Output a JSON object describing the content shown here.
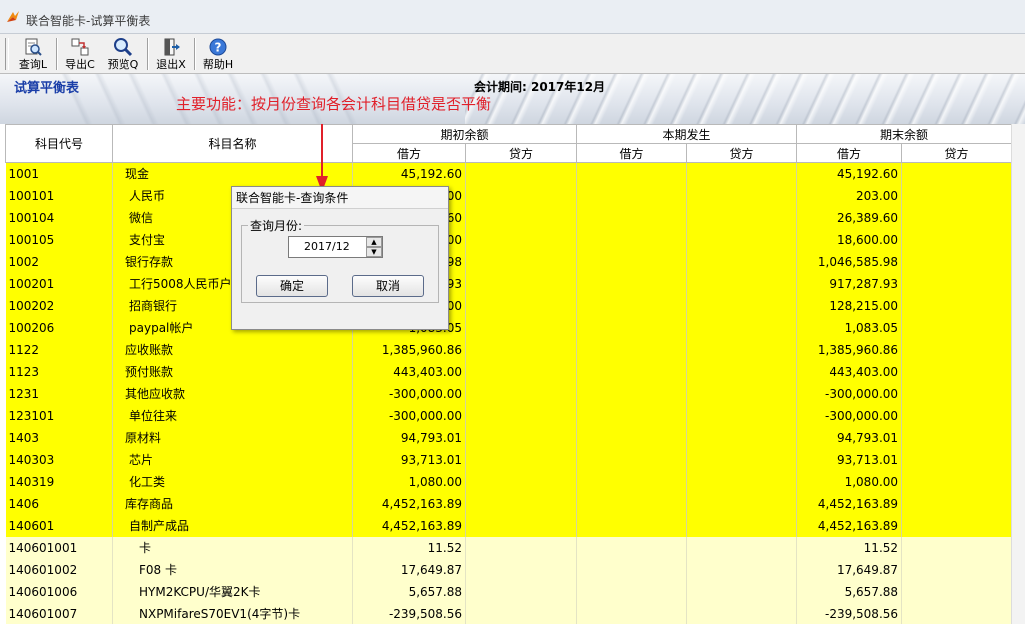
{
  "window": {
    "title": "联合智能卡-试算平衡表"
  },
  "toolbar": {
    "items": [
      {
        "label": "查询L",
        "icon": "query-icon"
      },
      {
        "label": "导出C",
        "icon": "export-icon"
      },
      {
        "label": "预览Q",
        "icon": "preview-icon"
      },
      {
        "label": "退出X",
        "icon": "exit-icon"
      },
      {
        "label": "帮助H",
        "icon": "help-icon"
      }
    ]
  },
  "banner": {
    "report_title": "试算平衡表",
    "period": "会计期间: 2017年12月",
    "annotation": "主要功能：按月份查询各会计科目借贷是否平衡"
  },
  "table": {
    "headers": {
      "code": "科目代号",
      "name": "科目名称",
      "opening": "期初余额",
      "current": "本期发生",
      "closing": "期末余额",
      "debit": "借方",
      "credit": "贷方"
    },
    "rows": [
      {
        "code": "1001",
        "name": "现金",
        "open_debit": "45,192.60",
        "close_debit": "45,192.60",
        "level": 0,
        "hl": true
      },
      {
        "code": "100101",
        "name": "人民币",
        "open_debit": "203.00",
        "close_debit": "203.00",
        "level": 1,
        "hl": true
      },
      {
        "code": "100104",
        "name": "微信",
        "open_debit": "26,389.60",
        "close_debit": "26,389.60",
        "level": 1,
        "hl": true
      },
      {
        "code": "100105",
        "name": "支付宝",
        "open_debit": "18,600.00",
        "close_debit": "18,600.00",
        "level": 1,
        "hl": true
      },
      {
        "code": "1002",
        "name": "银行存款",
        "open_debit": "1,046,585.98",
        "close_debit": "1,046,585.98",
        "level": 0,
        "hl": true
      },
      {
        "code": "100201",
        "name": "工行5008人民币户",
        "open_debit": "917,287.93",
        "close_debit": "917,287.93",
        "level": 1,
        "hl": true
      },
      {
        "code": "100202",
        "name": "招商银行",
        "open_debit": "128,215.00",
        "close_debit": "128,215.00",
        "level": 1,
        "hl": true
      },
      {
        "code": "100206",
        "name": "paypal帐户",
        "open_debit": "1,083.05",
        "close_debit": "1,083.05",
        "level": 1,
        "hl": true
      },
      {
        "code": "1122",
        "name": "应收账款",
        "open_debit": "1,385,960.86",
        "close_debit": "1,385,960.86",
        "level": 0,
        "hl": true
      },
      {
        "code": "1123",
        "name": "预付账款",
        "open_debit": "443,403.00",
        "close_debit": "443,403.00",
        "level": 0,
        "hl": true
      },
      {
        "code": "1231",
        "name": "其他应收款",
        "open_debit": "-300,000.00",
        "close_debit": "-300,000.00",
        "level": 0,
        "hl": true
      },
      {
        "code": "123101",
        "name": "单位往来",
        "open_debit": "-300,000.00",
        "close_debit": "-300,000.00",
        "level": 1,
        "hl": true
      },
      {
        "code": "1403",
        "name": "原材料",
        "open_debit": "94,793.01",
        "close_debit": "94,793.01",
        "level": 0,
        "hl": true
      },
      {
        "code": "140303",
        "name": "芯片",
        "open_debit": "93,713.01",
        "close_debit": "93,713.01",
        "level": 1,
        "hl": true
      },
      {
        "code": "140319",
        "name": "化工类",
        "open_debit": "1,080.00",
        "close_debit": "1,080.00",
        "level": 1,
        "hl": true
      },
      {
        "code": "1406",
        "name": "库存商品",
        "open_debit": "4,452,163.89",
        "close_debit": "4,452,163.89",
        "level": 0,
        "hl": true
      },
      {
        "code": "140601",
        "name": "自制产成品",
        "open_debit": "4,452,163.89",
        "close_debit": "4,452,163.89",
        "level": 1,
        "hl": true
      },
      {
        "code": "140601001",
        "name": "卡",
        "open_debit": "11.52",
        "close_debit": "11.52",
        "level": 2,
        "hl": false
      },
      {
        "code": "140601002",
        "name": "F08 卡",
        "open_debit": "17,649.87",
        "close_debit": "17,649.87",
        "level": 2,
        "hl": false
      },
      {
        "code": "140601006",
        "name": "HYM2KCPU/华翼2K卡",
        "open_debit": "5,657.88",
        "close_debit": "5,657.88",
        "level": 2,
        "hl": false
      },
      {
        "code": "140601007",
        "name": "NXPMifareS70EV1(4字节)卡",
        "open_debit": "-239,508.56",
        "close_debit": "-239,508.56",
        "level": 2,
        "hl": false
      }
    ]
  },
  "dialog": {
    "title": "联合智能卡-查询条件",
    "group_label": "查询月份:",
    "month_value": "2017/12",
    "ok_label": "确定",
    "cancel_label": "取消"
  }
}
